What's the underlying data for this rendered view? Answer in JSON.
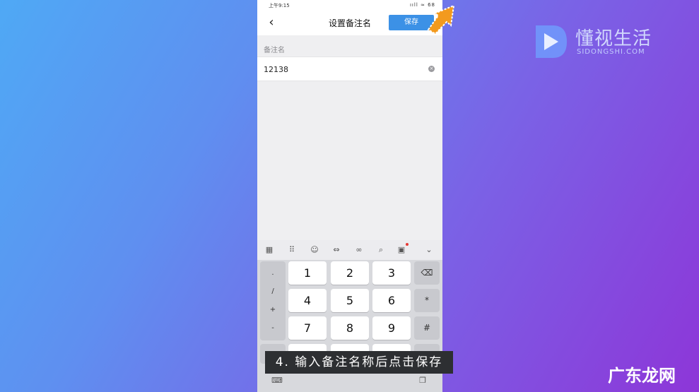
{
  "status_bar": {
    "time": "上午9:15",
    "right": "ııll ≈ 68"
  },
  "nav": {
    "title": "设置备注名",
    "save_label": "保存",
    "back_icon": "chevron-left-icon"
  },
  "remark": {
    "label": "备注名",
    "value": "12138"
  },
  "keyboard": {
    "toolbar_icons": [
      "grid-icon",
      "keypad-icon",
      "emoji-icon",
      "cursor-icon",
      "link-icon",
      "search-icon",
      "clipboard-icon",
      "collapse-icon"
    ],
    "symbols": [
      ".",
      "/",
      "+",
      "-"
    ],
    "keys": [
      [
        "1",
        "2",
        "3"
      ],
      [
        "4",
        "5",
        "6"
      ],
      [
        "7",
        "8",
        "9"
      ]
    ],
    "right_keys": [
      "⌫",
      "*",
      "#"
    ]
  },
  "caption": "4. 输入备注名称后点击保存",
  "watermark": {
    "title": "懂视生活",
    "sub": "SIDONGSHI.COM",
    "bottom": "广东龙网"
  },
  "colors": {
    "accent": "#3c91e6",
    "arrow": "#f39a1e"
  }
}
